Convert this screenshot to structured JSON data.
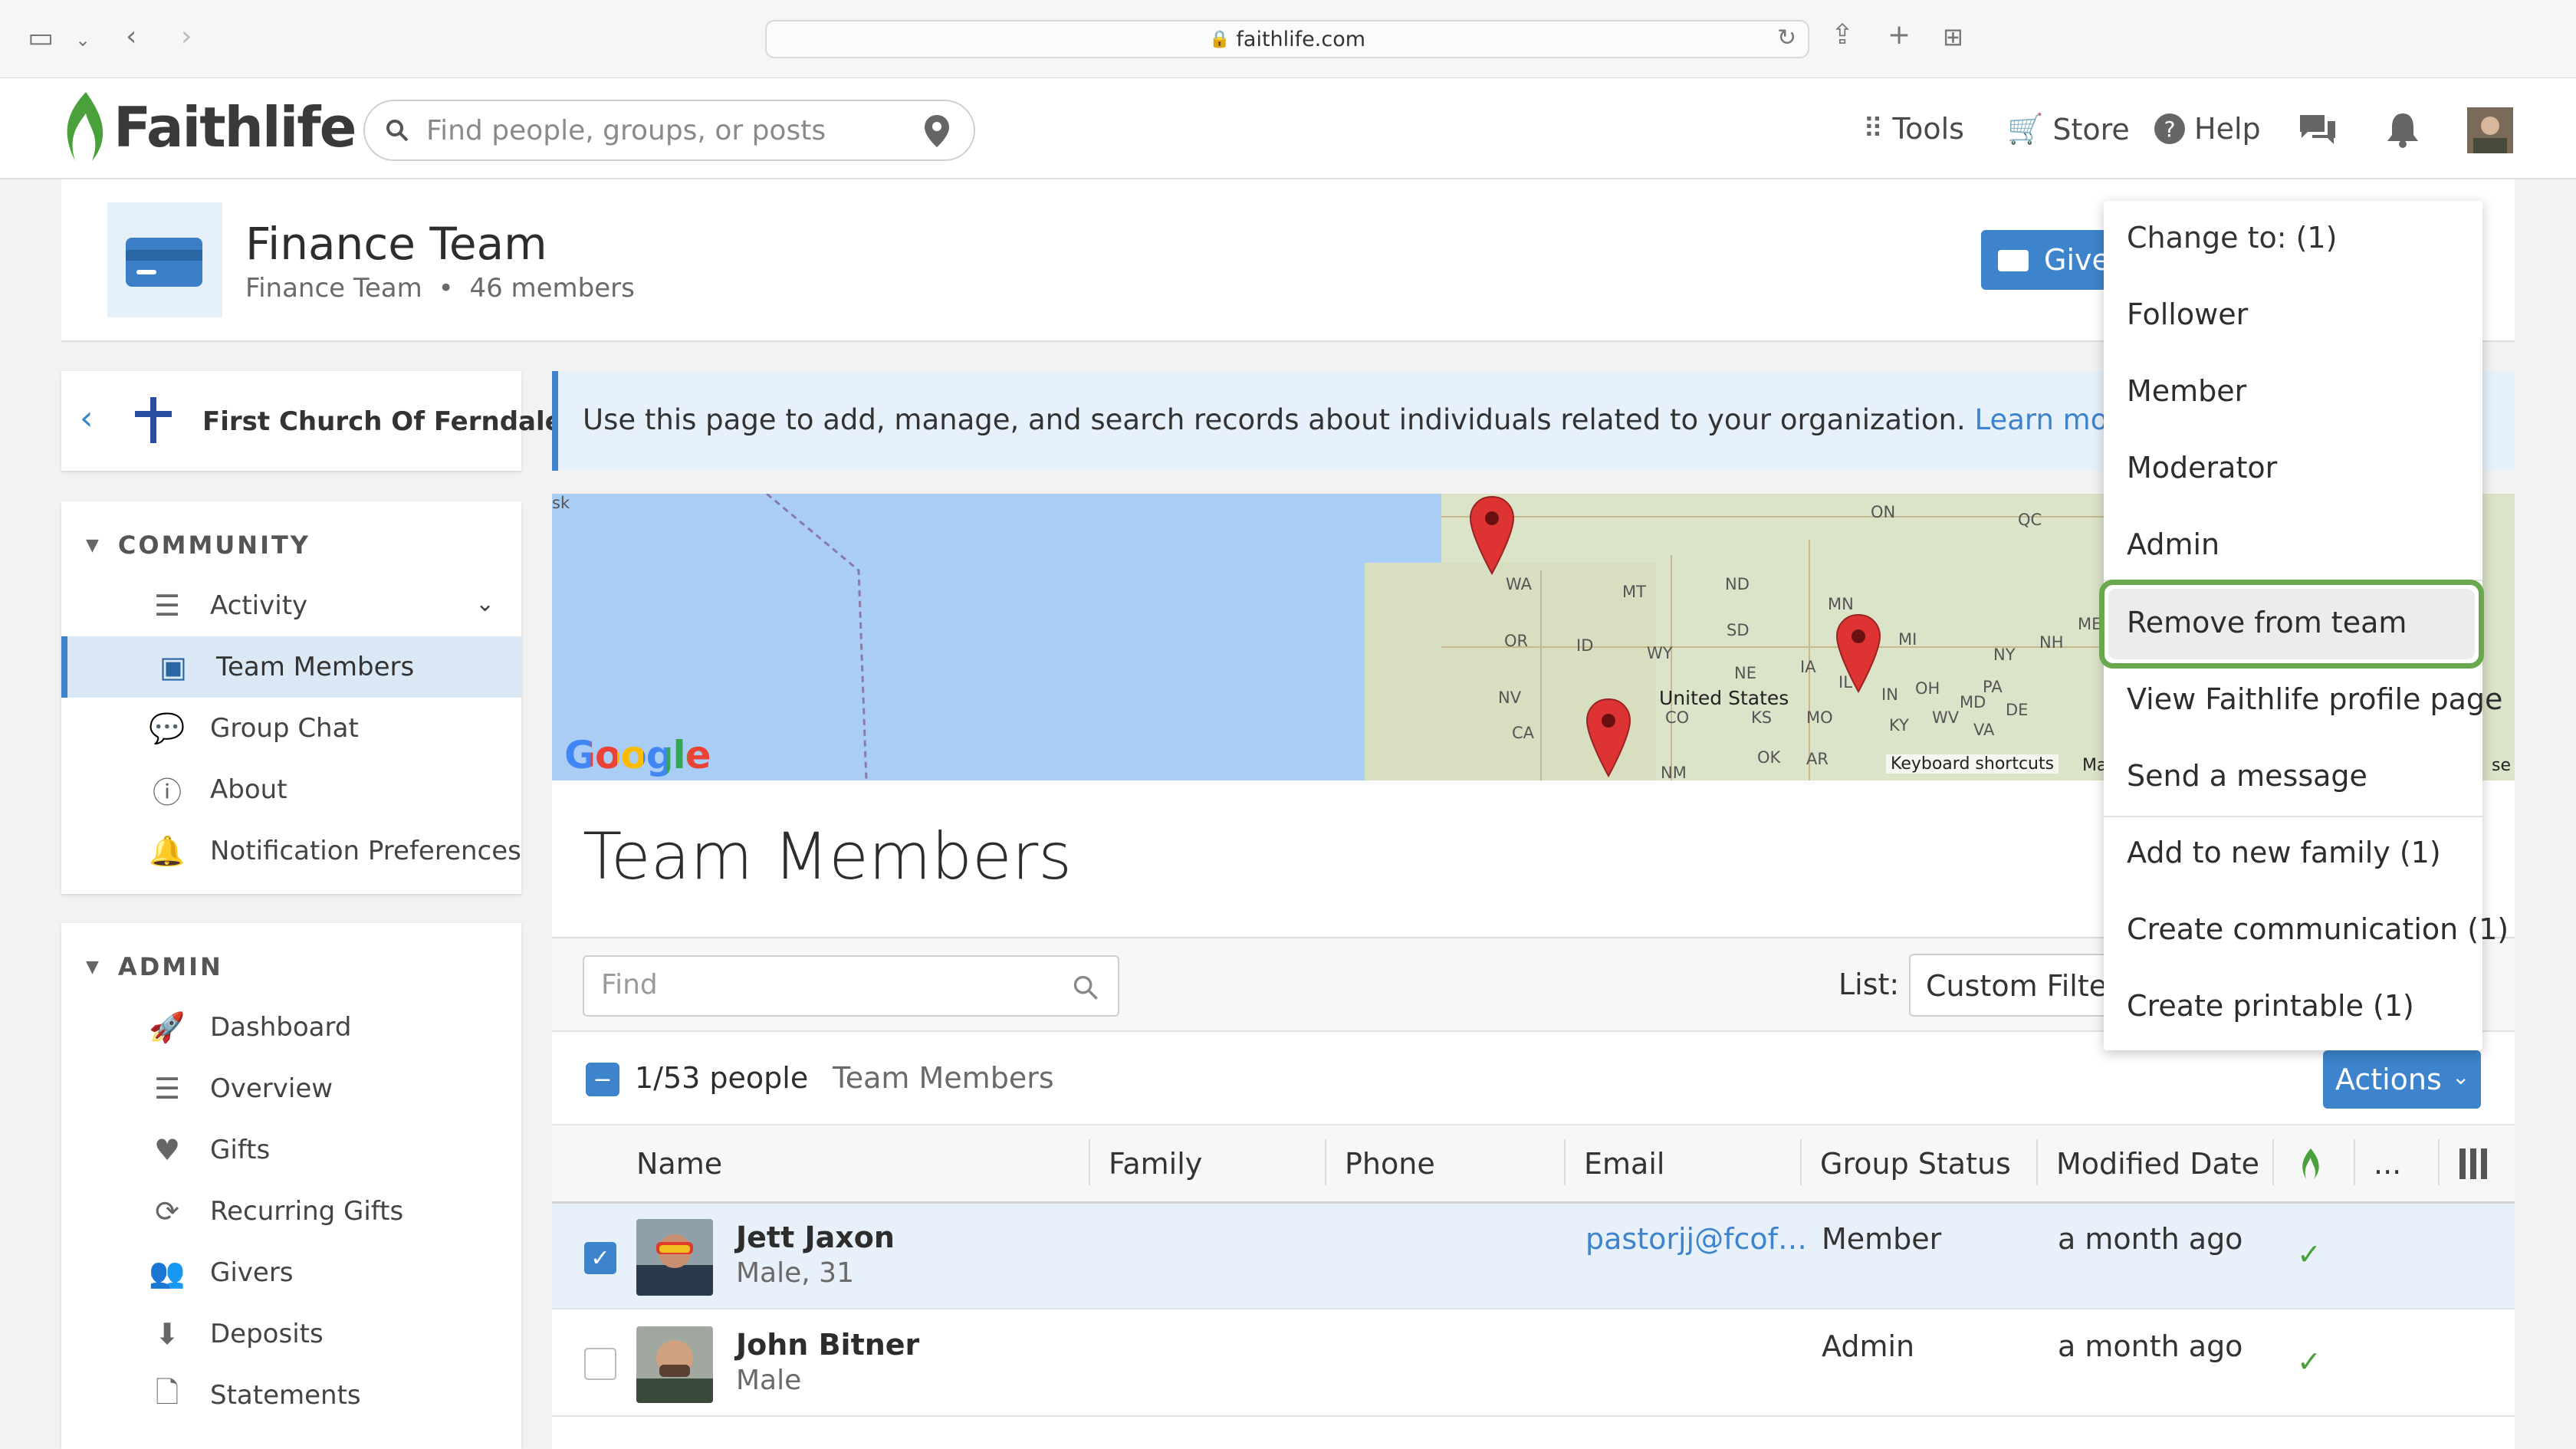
{
  "browser": {
    "url": "faithlife.com"
  },
  "topnav": {
    "logo": "Faithlife",
    "search_placeholder": "Find people, groups, or posts",
    "tools": "Tools",
    "store": "Store",
    "help": "Help"
  },
  "header": {
    "title": "Finance Team",
    "subtitle_group": "Finance Team",
    "bullet": "•",
    "member_count": "46 members",
    "give_label": "Give"
  },
  "sidebar": {
    "org_name": "First Church Of Ferndale",
    "community_heading": "COMMUNITY",
    "community_items": [
      {
        "label": "Activity"
      },
      {
        "label": "Team Members"
      },
      {
        "label": "Group Chat"
      },
      {
        "label": "About"
      },
      {
        "label": "Notification Preferences"
      }
    ],
    "admin_heading": "ADMIN",
    "admin_items": [
      {
        "label": "Dashboard"
      },
      {
        "label": "Overview"
      },
      {
        "label": "Gifts"
      },
      {
        "label": "Recurring Gifts"
      },
      {
        "label": "Givers"
      },
      {
        "label": "Deposits"
      },
      {
        "label": "Statements"
      }
    ]
  },
  "info": {
    "text": "Use this page to add, manage, and search records about individuals related to your organization.",
    "link": "Learn more."
  },
  "map": {
    "labels": [
      "ON",
      "QC",
      "WA",
      "MT",
      "ND",
      "MN",
      "OR",
      "ID",
      "WY",
      "SD",
      "NE",
      "IA",
      "IL",
      "MI",
      "NV",
      "CA",
      "CO",
      "KS",
      "MO",
      "United States",
      "OK",
      "AR",
      "NM",
      "KY",
      "WV",
      "VA",
      "PA",
      "NY",
      "OH",
      "IN",
      "MD",
      "DE",
      "NH",
      "ME",
      "sk",
      "Ma",
      "se"
    ],
    "google": "Google",
    "keyboard_shortcuts": "Keyboard shortcuts"
  },
  "main": {
    "heading": "Team Members",
    "find_placeholder": "Find",
    "list_label": "List:",
    "list_value": "Custom Filter",
    "count": "1/53 people",
    "list_name": "Team Members",
    "actions_label": "Actions",
    "columns": [
      "Name",
      "Family",
      "Phone",
      "Email",
      "Group Status",
      "Modified Date",
      "..."
    ],
    "rows": [
      {
        "name": "Jett Jaxon",
        "desc": "Male, 31",
        "email": "pastorjj@fcof…",
        "status": "Member",
        "modified": "a month ago",
        "checked": true
      },
      {
        "name": "John Bitner",
        "desc": "Male",
        "email": "",
        "status": "Admin",
        "modified": "a month ago",
        "checked": false
      }
    ]
  },
  "dropdown": {
    "items": [
      {
        "label": "Change to: (1)"
      },
      {
        "label": "Follower"
      },
      {
        "label": "Member"
      },
      {
        "label": "Moderator"
      },
      {
        "label": "Admin"
      },
      {
        "label": "Remove from team"
      },
      {
        "label": "View Faithlife profile page"
      },
      {
        "label": "Send a message"
      },
      {
        "label": "Add to new family (1)"
      },
      {
        "label": "Create communication (1)"
      },
      {
        "label": "Create printable (1)"
      }
    ]
  },
  "colors": {
    "accent": "#3d84cc",
    "brand_green": "#4aa03a",
    "highlight": "#6aa84f"
  }
}
